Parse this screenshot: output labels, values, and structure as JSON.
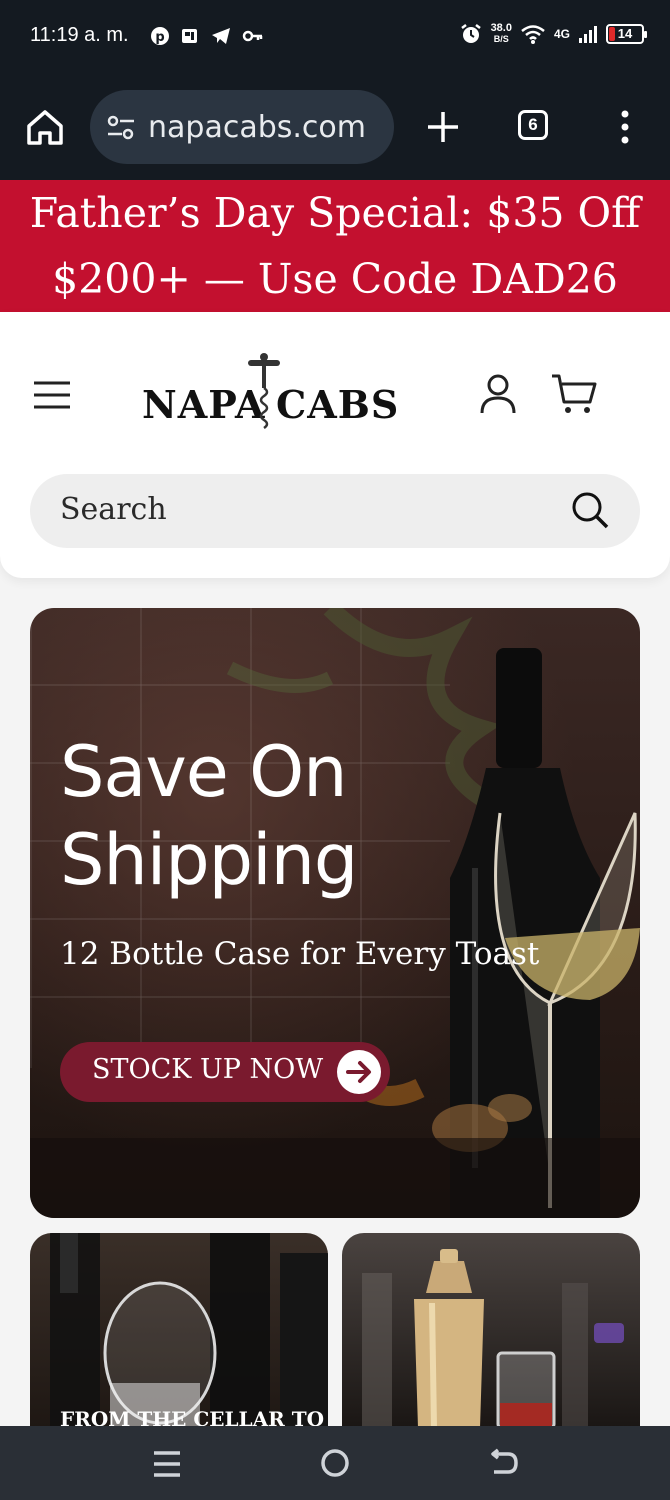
{
  "status_bar": {
    "time": "11:19 a. m.",
    "speed_value": "38.0",
    "speed_unit": "B/S",
    "network": "4G",
    "battery": "14"
  },
  "browser": {
    "url": "napacabs.com",
    "tab_count": "6"
  },
  "promo_banner": {
    "line1": "Father’s Day Special: $35 Off",
    "line2": "$200+ — Use Code DAD26",
    "background": "#c3102f"
  },
  "header": {
    "logo_left": "NAPA",
    "logo_right": "CABS",
    "search_placeholder": "Search"
  },
  "hero": {
    "title_line1": "Save On",
    "title_line2": "Shipping",
    "subtitle": "12 Bottle Case for Every Toast",
    "cta_label": "STOCK UP NOW",
    "cta_color": "#7a1a2e"
  },
  "cards": [
    {
      "label": "FROM THE CELLAR TO"
    },
    {
      "label": ""
    }
  ],
  "icons": {
    "home": "home-icon",
    "site_settings": "tune-icon",
    "new_tab": "plus-icon",
    "more": "more-vertical-icon",
    "menu": "hamburger-icon",
    "account": "user-icon",
    "cart": "cart-icon",
    "search": "search-icon",
    "cta": "arrow-right-circle-icon"
  }
}
